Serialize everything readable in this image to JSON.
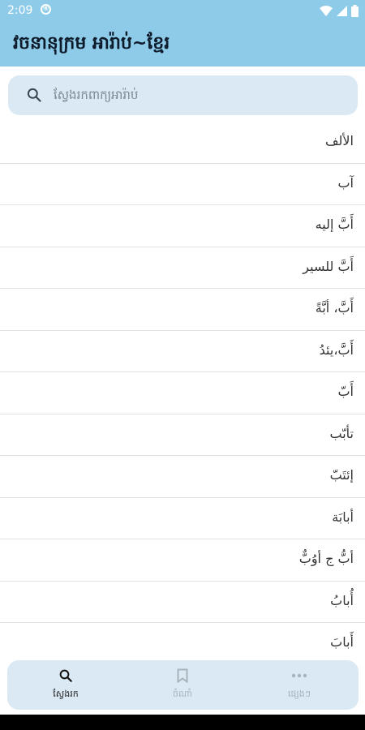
{
  "status_bar": {
    "time": "2:09",
    "indicator": "⑥"
  },
  "app_bar": {
    "title": "វចនានុក្រម អារ៉ាប់~ខ្មែរ"
  },
  "search": {
    "placeholder": "ស្វែងរកពាក្យអារ៉ាប់"
  },
  "words": [
    "الألف",
    "آب",
    "أَبَّ إليه",
    "أَبَّ للسير",
    "أَبَّ، أبَّةً",
    "أَبَّ،يئدُ",
    "أَبّ",
    "تأبّب",
    "إئتَبّ",
    "أبابَة",
    "أبُّ ج أوُبٌّ",
    "أُبابُ",
    "أَبابَ"
  ],
  "bottom_nav": {
    "items": [
      {
        "label": "ស្វែងរក",
        "icon": "search-icon"
      },
      {
        "label": "ចំណាំ",
        "icon": "bookmark-icon"
      },
      {
        "label": "ផ្សេងៗ",
        "icon": "more-horizontal-icon"
      }
    ]
  },
  "colors": {
    "app_bar": "#8ecbe8",
    "surface": "#dae9f3",
    "text": "#333333"
  }
}
